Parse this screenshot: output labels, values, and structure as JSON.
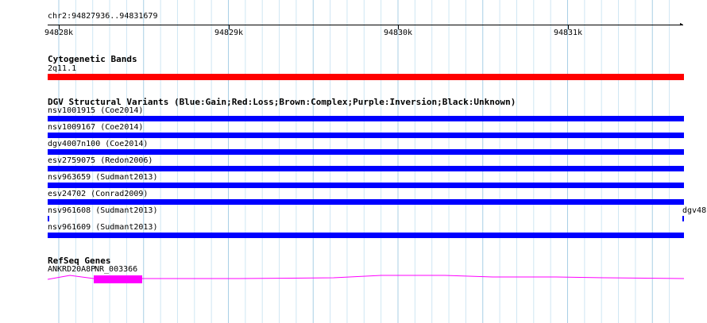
{
  "ruler": {
    "position_label": "chr2:94827936..94831679",
    "ticks": [
      "94828k",
      "94829k",
      "94830k",
      "94831k"
    ]
  },
  "cytoband": {
    "title": "Cytogenetic Bands",
    "label": "2q11.1",
    "color": "#ff0000"
  },
  "dgv": {
    "title": "DGV Structural Variants (Blue:Gain;Red:Loss;Brown:Complex;Purple:Inversion;Black:Unknown)",
    "color": "#0000ff",
    "items": [
      {
        "label": "nsv1001915 (Coe2014)"
      },
      {
        "label": "nsv1009167 (Coe2014)"
      },
      {
        "label": "dgv4007n100 (Coe2014)"
      },
      {
        "label": "esv2759075 (Redon2006)"
      },
      {
        "label": "nsv963659 (Sudmant2013)"
      },
      {
        "label": "esv24702 (Conrad2009)"
      },
      {
        "label": "nsv961608 (Sudmant2013)"
      },
      {
        "label": "nsv961609 (Sudmant2013)"
      }
    ],
    "edge_label": "dgv48"
  },
  "refseq": {
    "title": "RefSeq Genes",
    "gene_label": "ANKRD20A8P",
    "transcript_label": "NR_003366",
    "color": "#ff00ff"
  }
}
